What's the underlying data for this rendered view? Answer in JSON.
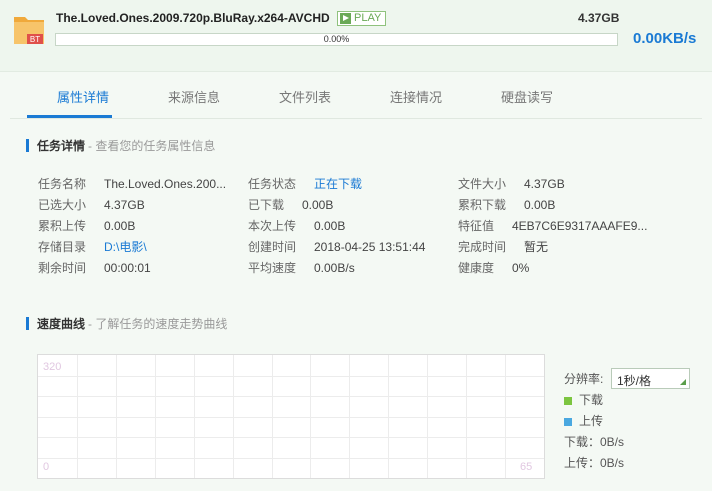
{
  "task": {
    "file_name": "The.Loved.Ones.2009.720p.BluRay.x264-AVCHD",
    "play_label": "PLAY",
    "size": "4.37GB",
    "progress_text": "0.00%",
    "progress_fraction": 0.0,
    "speed": "0.00KB/s",
    "icon_badge": "BT"
  },
  "tabs": [
    {
      "label": "属性详情",
      "active": true
    },
    {
      "label": "来源信息",
      "active": false
    },
    {
      "label": "文件列表",
      "active": false
    },
    {
      "label": "连接情况",
      "active": false
    },
    {
      "label": "硬盘读写",
      "active": false
    }
  ],
  "details_section": {
    "title": "任务详情",
    "subtitle": "- 查看您的任务属性信息"
  },
  "details": [
    {
      "key": "任务名称",
      "value": "The.Loved.Ones.200..."
    },
    {
      "key": "任务状态",
      "value": "正在下载"
    },
    {
      "key": "文件大小",
      "value": "4.37GB"
    },
    {
      "key": "已选大小",
      "value": "4.37GB"
    },
    {
      "key": "已下载",
      "value": "0.00B"
    },
    {
      "key": "累积下载",
      "value": "0.00B"
    },
    {
      "key": "累积上传",
      "value": "0.00B"
    },
    {
      "key": "本次上传",
      "value": "0.00B"
    },
    {
      "key": "特征值",
      "value": "4EB7C6E9317AAAFE9..."
    },
    {
      "key": "存储目录",
      "value": "D:\\电影\\"
    },
    {
      "key": "创建时间",
      "value": "2018-04-25 13:51:44"
    },
    {
      "key": "完成时间",
      "value": "暂无"
    },
    {
      "key": "剩余时间",
      "value": "00:00:01"
    },
    {
      "key": "平均速度",
      "value": "0.00B/s"
    },
    {
      "key": "健康度",
      "value": "0%"
    }
  ],
  "speed_section": {
    "title": "速度曲线",
    "subtitle": "- 了解任务的速度走势曲线"
  },
  "chart": {
    "y_max_label": "320",
    "y_min_label": "0",
    "x_max_label": "65",
    "resolution_label": "分辨率:",
    "resolution_value": "1秒/格",
    "legend_download": "下载",
    "legend_upload": "上传",
    "download_color": "#7cc540",
    "upload_color": "#4aa8e0",
    "download_rate": "下载：0B/s",
    "upload_rate": "上传：0B/s"
  }
}
